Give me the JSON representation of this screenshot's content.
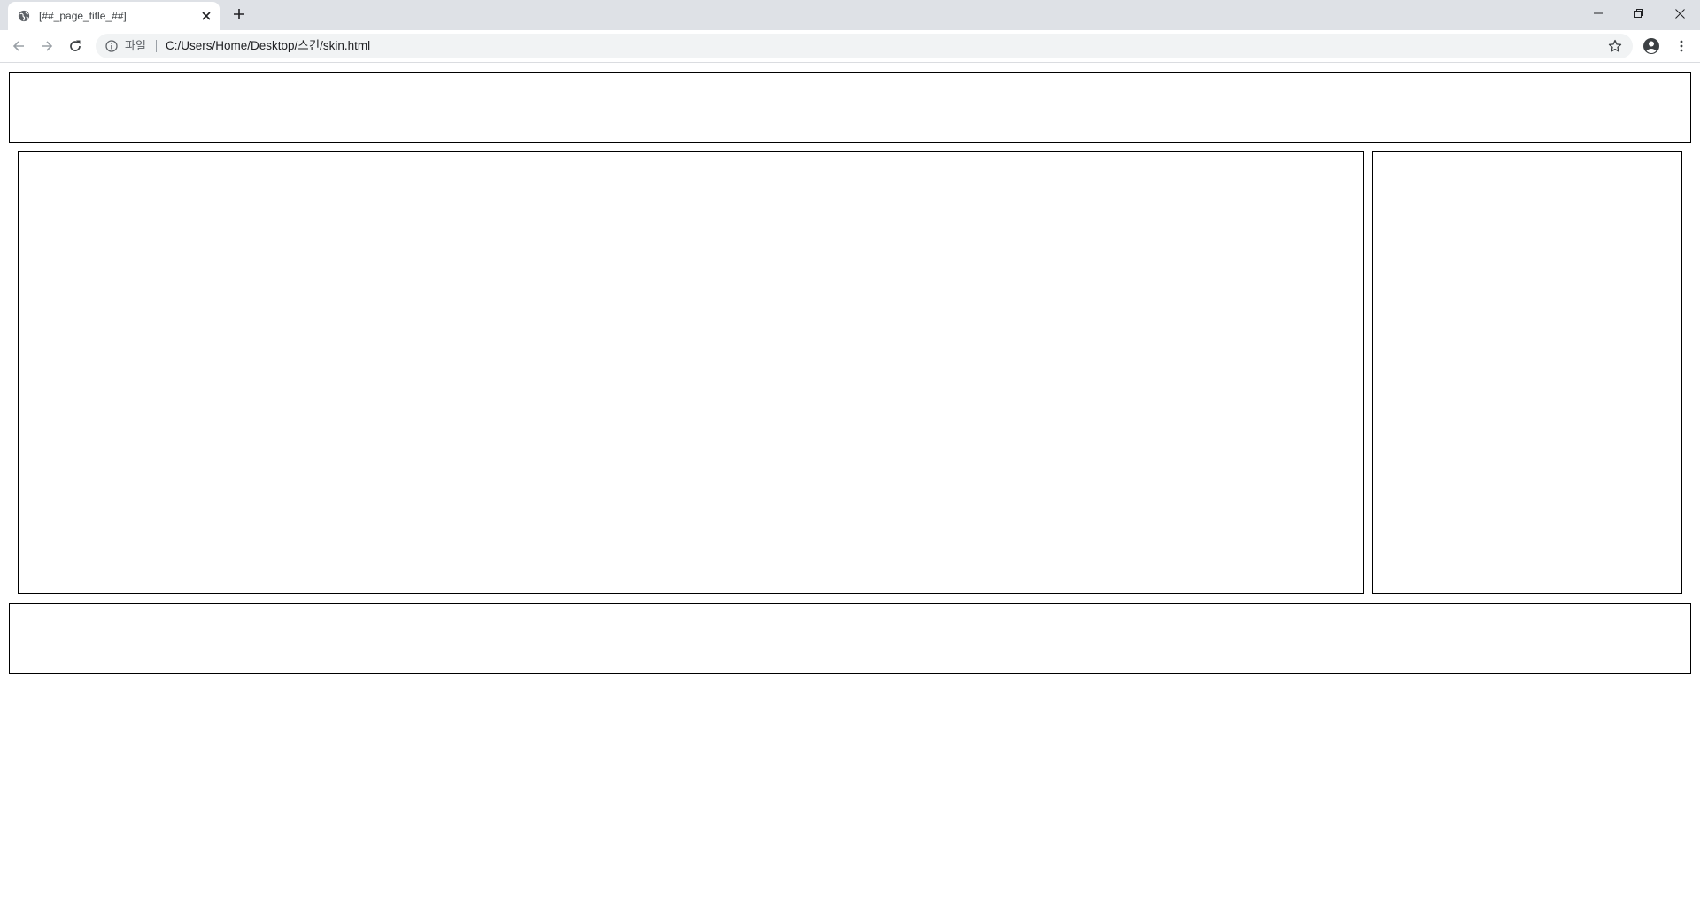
{
  "browser": {
    "tab": {
      "title": "[##_page_title_##]"
    },
    "address_bar": {
      "scheme_label": "파일",
      "url": "C:/Users/Home/Desktop/스킨/skin.html"
    },
    "icons": {
      "favicon": "globe-icon",
      "close_tab": "close-icon",
      "new_tab": "plus-icon",
      "back": "arrow-left-icon",
      "forward": "arrow-right-icon",
      "reload": "reload-icon",
      "site_info": "info-icon",
      "bookmark": "star-icon",
      "profile": "account-circle-icon",
      "menu": "kebab-menu-icon",
      "minimize": "minimize-icon",
      "restore": "restore-icon",
      "close_window": "close-icon"
    }
  },
  "page": {
    "regions": [
      "header",
      "content",
      "sidebar",
      "footer"
    ]
  }
}
